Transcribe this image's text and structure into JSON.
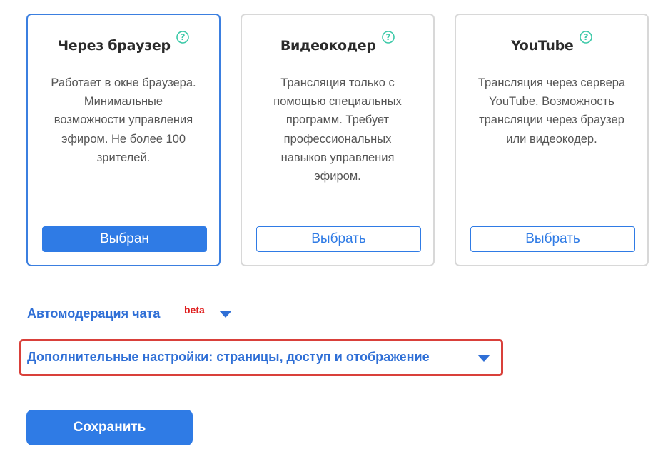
{
  "cards": [
    {
      "title": "Через браузер",
      "description": "Работает в окне браузера. Минимальные возможности управления эфиром. Не более 100 зрителей.",
      "button_label": "Выбран",
      "state": "selected"
    },
    {
      "title": "Видеокодер",
      "description": "Трансляция только с помощью специальных программ. Требует профессиональных навыков управления эфиром.",
      "button_label": "Выбрать",
      "state": "unselected"
    },
    {
      "title": "YouTube",
      "description": "Трансляция через сервера YouTube. Возможность трансляции через браузер или видеокодер.",
      "button_label": "Выбрать",
      "state": "unselected"
    }
  ],
  "help_icon": "question-circle-icon",
  "chat_moderation": {
    "label": "Автомодерация чата",
    "badge": "beta"
  },
  "advanced_settings": {
    "label": "Дополнительные настройки: страницы, доступ и отображение"
  },
  "save_button": {
    "label": "Сохранить"
  },
  "colors": {
    "accent": "#2f7be5",
    "link": "#2f6fd6",
    "help_icon": "#3cc9a8",
    "badge": "#e02020",
    "highlight": "#d9403a"
  }
}
